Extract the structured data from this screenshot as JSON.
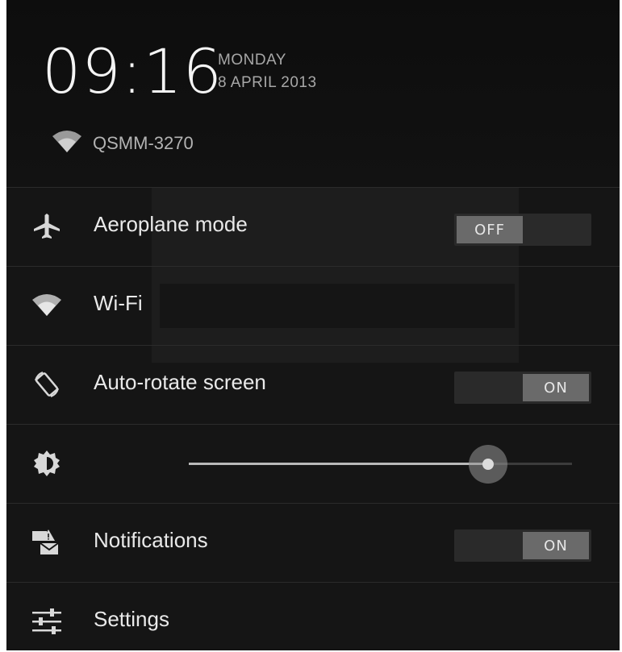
{
  "clock": {
    "time": "09:16",
    "day": "MONDAY",
    "date": "8 APRIL 2013"
  },
  "connection": {
    "icon": "wifi-icon",
    "ssid": "QSMM-3270"
  },
  "quick_settings": [
    {
      "icon": "airplane-icon",
      "label": "Aeroplane mode",
      "toggle": "OFF"
    },
    {
      "icon": "wifi-icon",
      "label": "Wi-Fi"
    },
    {
      "icon": "auto-rotate-icon",
      "label": "Auto-rotate screen",
      "toggle": "ON"
    },
    {
      "icon": "brightness-icon",
      "brightness_level": 0.78
    },
    {
      "icon": "notifications-icon",
      "label": "Notifications",
      "toggle": "ON"
    },
    {
      "icon": "settings-sliders-icon",
      "label": "Settings"
    }
  ],
  "colors": {
    "panel_bg": "#151515",
    "divider": "#2b2b2b",
    "toggle_thumb": "#6a6a6a"
  }
}
